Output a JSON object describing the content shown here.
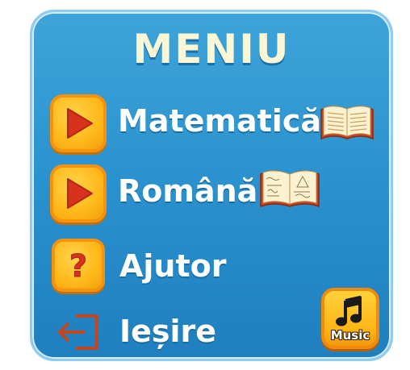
{
  "menu": {
    "title": "MENIU",
    "items": [
      {
        "label": "Matematică",
        "icon": "play-icon",
        "extra_icon": "open-book-icon"
      },
      {
        "label": "Română",
        "icon": "play-icon",
        "extra_icon": "open-book-icon"
      },
      {
        "label": "Ajutor",
        "icon": "question-mark-icon"
      },
      {
        "label": "Ieșire",
        "icon": "exit-door-icon"
      }
    ],
    "music_button": {
      "label": "Music",
      "icon": "music-note-icon"
    }
  },
  "colors": {
    "panel": "#2b93cf",
    "button_fill": "#ffb81a",
    "button_border": "#f7920c",
    "play_triangle": "#d6321c",
    "title_text": "#fbf6d3",
    "exit_icon": "#c4461c"
  }
}
